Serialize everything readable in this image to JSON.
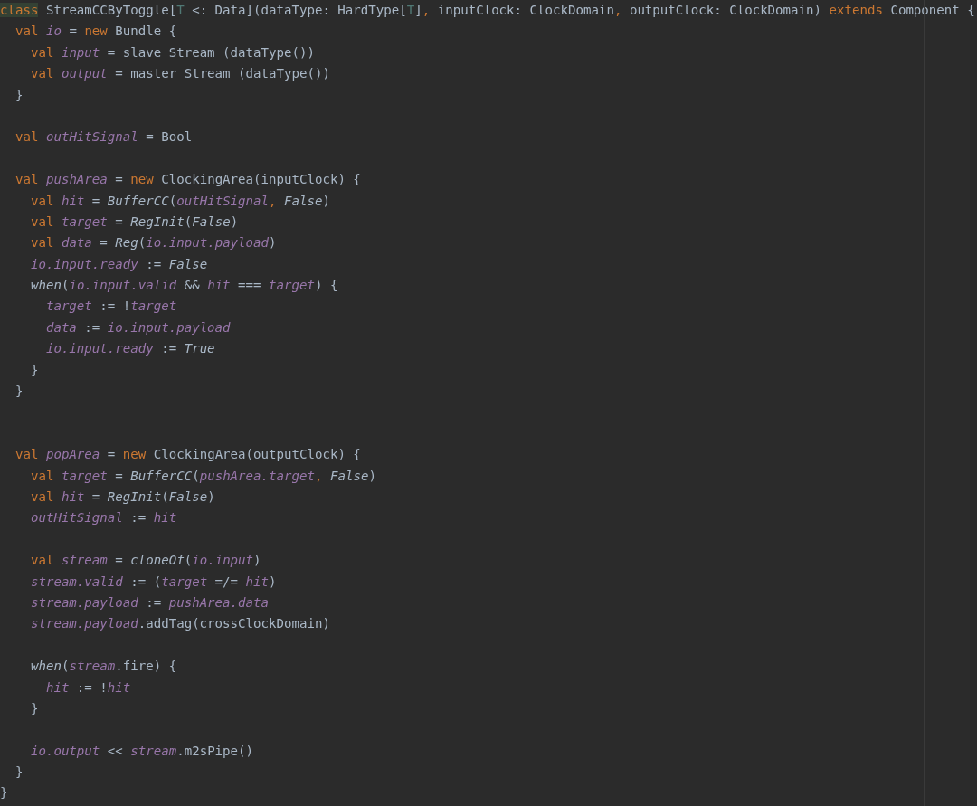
{
  "editor": {
    "blocks": [
      {
        "kind": "first",
        "lines": [
          {
            "tokens": [
              {
                "text": "class",
                "kind": "keyword_match"
              },
              {
                "text": " StreamCCByToggle[",
                "kind": "plain"
              },
              {
                "text": "T",
                "kind": "type_param"
              },
              {
                "text": " <: Data](dataType: HardType[",
                "kind": "plain"
              },
              {
                "text": "T",
                "kind": "type_param"
              },
              {
                "text": "]",
                "kind": "plain"
              },
              {
                "text": ",",
                "kind": "punct"
              },
              {
                "text": " inputClock: ClockDomain",
                "kind": "plain"
              },
              {
                "text": ",",
                "kind": "punct"
              },
              {
                "text": " outputClock: ClockDomain) ",
                "kind": "plain"
              },
              {
                "text": "extends",
                "kind": "keyword"
              },
              {
                "text": " Component {",
                "kind": "plain"
              }
            ]
          },
          {
            "tokens": [
              {
                "text": "  val ",
                "kind": "keyword"
              },
              {
                "text": "io",
                "kind": "field"
              },
              {
                "text": " = ",
                "kind": "plain"
              },
              {
                "text": "new",
                "kind": "keyword"
              },
              {
                "text": " Bundle {",
                "kind": "plain"
              }
            ]
          },
          {
            "tokens": [
              {
                "text": "    val ",
                "kind": "keyword"
              },
              {
                "text": "input",
                "kind": "field"
              },
              {
                "text": " = slave Stream (dataType())",
                "kind": "plain"
              }
            ]
          },
          {
            "tokens": [
              {
                "text": "    val ",
                "kind": "keyword"
              },
              {
                "text": "output",
                "kind": "field"
              },
              {
                "text": " = master Stream (dataType())",
                "kind": "plain"
              }
            ]
          },
          {
            "tokens": [
              {
                "text": "  }",
                "kind": "plain"
              }
            ]
          }
        ]
      },
      {
        "kind": "gap",
        "lines": [
          {
            "tokens": [
              {
                "text": "  val ",
                "kind": "keyword"
              },
              {
                "text": "outHitSignal",
                "kind": "field"
              },
              {
                "text": " = Bool",
                "kind": "plain"
              }
            ]
          }
        ]
      },
      {
        "kind": "gap",
        "lines": [
          {
            "tokens": [
              {
                "text": "  val ",
                "kind": "keyword"
              },
              {
                "text": "pushArea",
                "kind": "field"
              },
              {
                "text": " = ",
                "kind": "plain"
              },
              {
                "text": "new",
                "kind": "keyword"
              },
              {
                "text": " ClockingArea(inputClock) {",
                "kind": "plain"
              }
            ]
          },
          {
            "tokens": [
              {
                "text": "    val ",
                "kind": "keyword"
              },
              {
                "text": "hit",
                "kind": "field"
              },
              {
                "text": " = ",
                "kind": "plain"
              },
              {
                "text": "BufferCC",
                "kind": "call"
              },
              {
                "text": "(",
                "kind": "plain"
              },
              {
                "text": "outHitSignal",
                "kind": "field"
              },
              {
                "text": ", ",
                "kind": "punct"
              },
              {
                "text": "False",
                "kind": "call"
              },
              {
                "text": ")",
                "kind": "plain"
              }
            ]
          },
          {
            "tokens": [
              {
                "text": "    val ",
                "kind": "keyword"
              },
              {
                "text": "target",
                "kind": "field"
              },
              {
                "text": " = ",
                "kind": "plain"
              },
              {
                "text": "RegInit",
                "kind": "call"
              },
              {
                "text": "(",
                "kind": "plain"
              },
              {
                "text": "False",
                "kind": "call"
              },
              {
                "text": ")",
                "kind": "plain"
              }
            ]
          },
          {
            "tokens": [
              {
                "text": "    val ",
                "kind": "keyword"
              },
              {
                "text": "data",
                "kind": "field"
              },
              {
                "text": " = ",
                "kind": "plain"
              },
              {
                "text": "Reg",
                "kind": "call"
              },
              {
                "text": "(",
                "kind": "plain"
              },
              {
                "text": "io.input.payload",
                "kind": "field"
              },
              {
                "text": ")",
                "kind": "plain"
              }
            ]
          },
          {
            "tokens": [
              {
                "text": "    io.input.ready",
                "kind": "field"
              },
              {
                "text": " := ",
                "kind": "plain"
              },
              {
                "text": "False",
                "kind": "call"
              }
            ]
          },
          {
            "tokens": [
              {
                "text": "    when",
                "kind": "call"
              },
              {
                "text": "(",
                "kind": "plain"
              },
              {
                "text": "io.input.valid",
                "kind": "field"
              },
              {
                "text": " && ",
                "kind": "plain"
              },
              {
                "text": "hit",
                "kind": "field"
              },
              {
                "text": " === ",
                "kind": "plain"
              },
              {
                "text": "target",
                "kind": "field"
              },
              {
                "text": ") {",
                "kind": "plain"
              }
            ]
          },
          {
            "tokens": [
              {
                "text": "      target",
                "kind": "field"
              },
              {
                "text": " := !",
                "kind": "plain"
              },
              {
                "text": "target",
                "kind": "field"
              }
            ]
          },
          {
            "tokens": [
              {
                "text": "      data",
                "kind": "field"
              },
              {
                "text": " := ",
                "kind": "plain"
              },
              {
                "text": "io.input.payload",
                "kind": "field"
              }
            ]
          },
          {
            "tokens": [
              {
                "text": "      io.input.ready",
                "kind": "field"
              },
              {
                "text": " := ",
                "kind": "plain"
              },
              {
                "text": "True",
                "kind": "call"
              }
            ]
          },
          {
            "tokens": [
              {
                "text": "    }",
                "kind": "plain"
              }
            ]
          },
          {
            "tokens": [
              {
                "text": "  }",
                "kind": "plain"
              }
            ]
          }
        ]
      },
      {
        "kind": "wide_gap",
        "lines": [
          {
            "tokens": [
              {
                "text": "  val ",
                "kind": "keyword"
              },
              {
                "text": "popArea",
                "kind": "field"
              },
              {
                "text": " = ",
                "kind": "plain"
              },
              {
                "text": "new",
                "kind": "keyword"
              },
              {
                "text": " ClockingArea(outputClock) {",
                "kind": "plain"
              }
            ]
          },
          {
            "tokens": [
              {
                "text": "    val ",
                "kind": "keyword"
              },
              {
                "text": "target",
                "kind": "field"
              },
              {
                "text": " = ",
                "kind": "plain"
              },
              {
                "text": "BufferCC",
                "kind": "call"
              },
              {
                "text": "(",
                "kind": "plain"
              },
              {
                "text": "pushArea.target",
                "kind": "field"
              },
              {
                "text": ", ",
                "kind": "punct"
              },
              {
                "text": "False",
                "kind": "call"
              },
              {
                "text": ")",
                "kind": "plain"
              }
            ]
          },
          {
            "tokens": [
              {
                "text": "    val ",
                "kind": "keyword"
              },
              {
                "text": "hit",
                "kind": "field"
              },
              {
                "text": " = ",
                "kind": "plain"
              },
              {
                "text": "RegInit",
                "kind": "call"
              },
              {
                "text": "(",
                "kind": "plain"
              },
              {
                "text": "False",
                "kind": "call"
              },
              {
                "text": ")",
                "kind": "plain"
              }
            ]
          },
          {
            "tokens": [
              {
                "text": "    outHitSignal",
                "kind": "field"
              },
              {
                "text": " := ",
                "kind": "plain"
              },
              {
                "text": "hit",
                "kind": "field"
              }
            ]
          }
        ]
      },
      {
        "kind": "gap",
        "lines": [
          {
            "tokens": [
              {
                "text": "    val ",
                "kind": "keyword"
              },
              {
                "text": "stream",
                "kind": "field"
              },
              {
                "text": " = ",
                "kind": "plain"
              },
              {
                "text": "cloneOf",
                "kind": "call"
              },
              {
                "text": "(",
                "kind": "plain"
              },
              {
                "text": "io.input",
                "kind": "field"
              },
              {
                "text": ")",
                "kind": "plain"
              }
            ]
          },
          {
            "tokens": [
              {
                "text": "    stream.valid",
                "kind": "field"
              },
              {
                "text": " := (",
                "kind": "plain"
              },
              {
                "text": "target",
                "kind": "field"
              },
              {
                "text": " =/= ",
                "kind": "plain"
              },
              {
                "text": "hit",
                "kind": "field"
              },
              {
                "text": ")",
                "kind": "plain"
              }
            ]
          },
          {
            "tokens": [
              {
                "text": "    stream.payload",
                "kind": "field"
              },
              {
                "text": " := ",
                "kind": "plain"
              },
              {
                "text": "pushArea.data",
                "kind": "field"
              }
            ]
          },
          {
            "tokens": [
              {
                "text": "    stream.payload",
                "kind": "field"
              },
              {
                "text": ".addTag(crossClockDomain)",
                "kind": "plain"
              }
            ]
          }
        ]
      },
      {
        "kind": "gap",
        "lines": [
          {
            "tokens": [
              {
                "text": "    when",
                "kind": "call"
              },
              {
                "text": "(",
                "kind": "plain"
              },
              {
                "text": "stream",
                "kind": "field"
              },
              {
                "text": ".fire) {",
                "kind": "plain"
              }
            ]
          },
          {
            "tokens": [
              {
                "text": "      hit",
                "kind": "field"
              },
              {
                "text": " := !",
                "kind": "plain"
              },
              {
                "text": "hit",
                "kind": "field"
              }
            ]
          },
          {
            "tokens": [
              {
                "text": "    }",
                "kind": "plain"
              }
            ]
          }
        ]
      },
      {
        "kind": "gap",
        "lines": [
          {
            "tokens": [
              {
                "text": "    io.output",
                "kind": "field"
              },
              {
                "text": " << ",
                "kind": "plain"
              },
              {
                "text": "stream",
                "kind": "field"
              },
              {
                "text": ".m2sPipe()",
                "kind": "plain"
              }
            ]
          },
          {
            "tokens": [
              {
                "text": "  }",
                "kind": "plain"
              }
            ]
          },
          {
            "tokens": [
              {
                "text": "}",
                "kind": "plain"
              }
            ]
          }
        ]
      }
    ]
  }
}
